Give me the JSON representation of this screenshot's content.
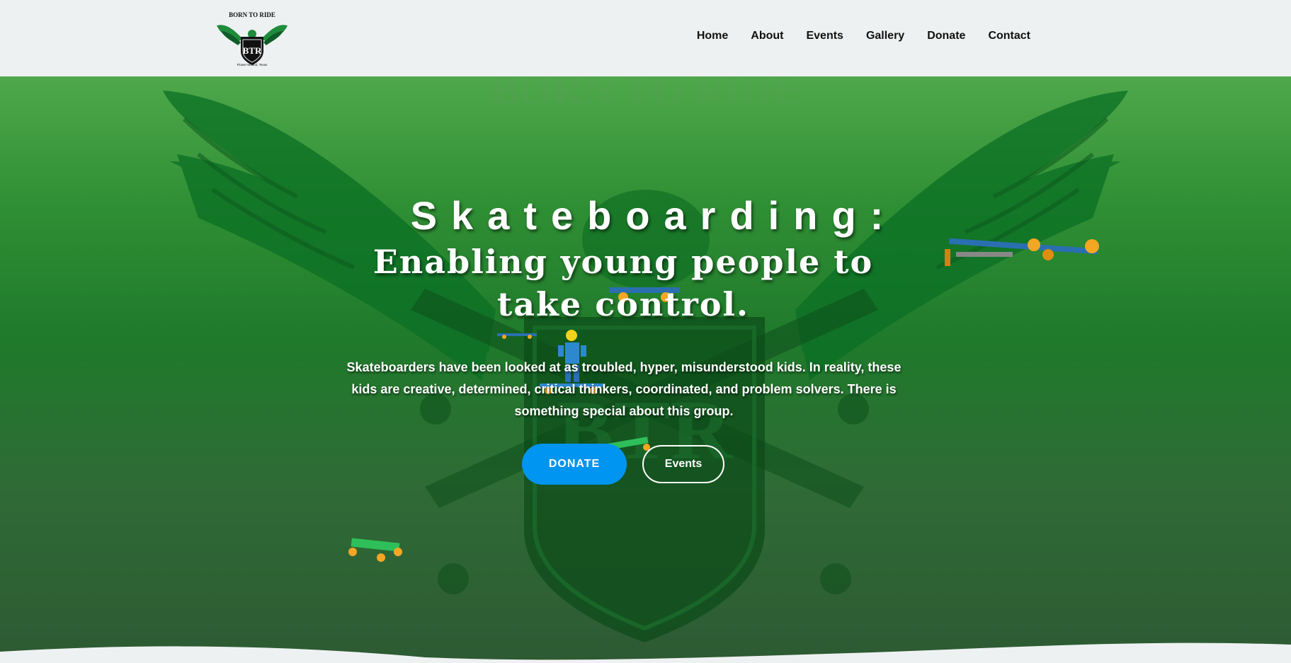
{
  "header": {
    "logo": {
      "top_text": "BORN TO RIDE",
      "monogram": "BTR",
      "bottom_text": "Flower Mound, Texas"
    },
    "nav": [
      "Home",
      "About",
      "Events",
      "Gallery",
      "Donate",
      "Contact"
    ]
  },
  "hero": {
    "title": "Skateboarding:",
    "subtitle": "Enabling young people to take control.",
    "description": "Skateboarders have been looked at as troubled, hyper, misunderstood kids. In reality, these kids are creative, determined, critical thinkers, coordinated, and problem solvers. There is something special about this group.",
    "donate_label": "DONATE",
    "events_label": "Events"
  },
  "colors": {
    "accent": "#0095f0",
    "hero_green": "#2f8f34",
    "header_bg": "#eef1f1"
  }
}
